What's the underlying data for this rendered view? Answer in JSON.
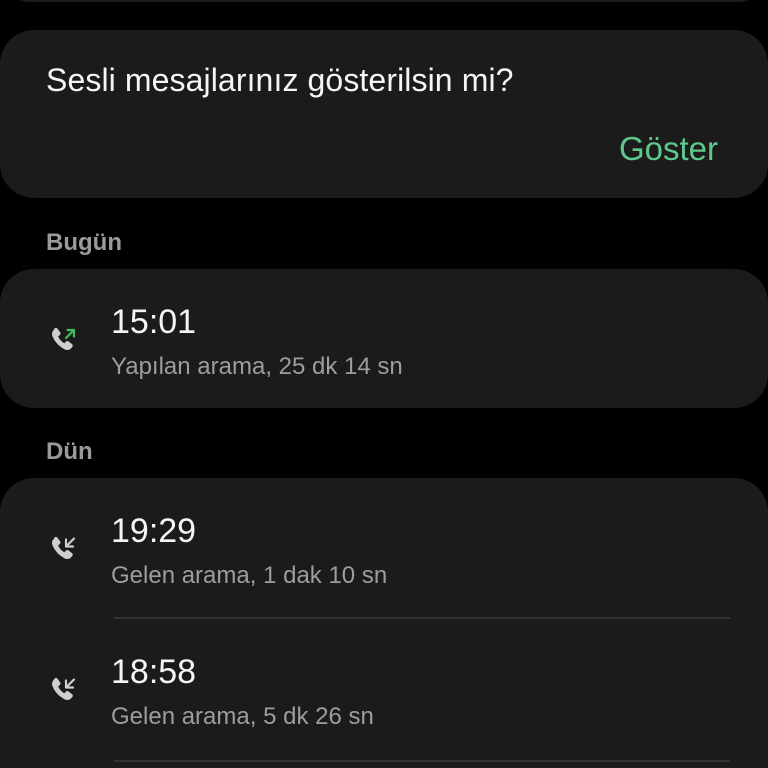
{
  "voicemail": {
    "question": "Sesli mesajlarınız gösterilsin mi?",
    "show_label": "Göster"
  },
  "sections": {
    "today": {
      "header": "Bugün",
      "calls": [
        {
          "time": "15:01",
          "detail": "Yapılan arama, 25 dk 14 sn",
          "icon": "outgoing-call-icon"
        }
      ]
    },
    "yesterday": {
      "header": "Dün",
      "calls": [
        {
          "time": "19:29",
          "detail": "Gelen arama, 1 dak 10 sn",
          "icon": "incoming-call-icon"
        },
        {
          "time": "18:58",
          "detail": "Gelen arama, 5 dk 26 sn",
          "icon": "incoming-call-icon"
        }
      ]
    }
  },
  "colors": {
    "background": "#000000",
    "card": "#1b1b1b",
    "accent": "#5fc98d",
    "primary_text": "#f5f5f5",
    "secondary_text": "#9d9d9d",
    "outgoing_arrow": "#3fbf5a",
    "incoming_arrow": "#cfcfcf"
  }
}
